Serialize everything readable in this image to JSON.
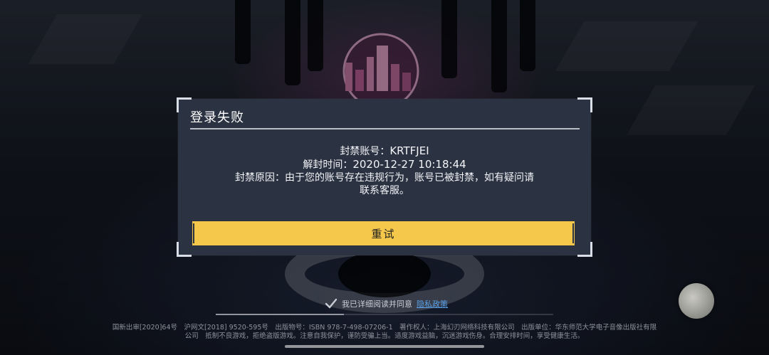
{
  "dialog": {
    "title": "登录失败",
    "ban_account_label": "封禁账号：",
    "ban_account_value": "KRTFJEI",
    "unban_time_label": "解封时间：",
    "unban_time_value": "2020-12-27 10:18:44",
    "reason_line1": "封禁原因：由于您的账号存在违规行为，账号已被封禁，如有疑问请",
    "reason_line2": "联系客服。",
    "retry_label": "重试"
  },
  "agreement": {
    "checked": true,
    "text": "我已详细阅读并同意",
    "link_text": "隐私政策"
  },
  "legal": {
    "line1": "国新出审[2020]64号　沪网文[2018] 9520-595号　出版物号：ISBN 978-7-498-07206-1　著作权人：上海幻刃网络科技有限公司　出版单位：华东师范大学电子音像出版社有限",
    "line2": "公司　抵制不良游戏，拒绝盗版游戏。注意自我保护，谨防受骗上当。适度游戏益脑，沉迷游戏伤身。合理安排时间，享受健康生活。"
  },
  "colors": {
    "dialog_bg": "#2b3241",
    "button_accent": "#f5c84c",
    "link": "#5aa0e8"
  },
  "icons": {
    "agree_check": "checkmark-icon",
    "floating_button": "moon-icon"
  }
}
